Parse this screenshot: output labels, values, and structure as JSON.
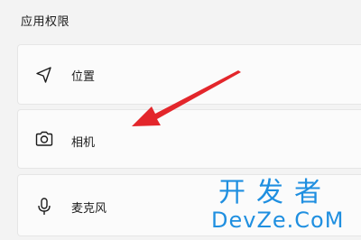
{
  "section": {
    "title": "应用权限"
  },
  "permissions": [
    {
      "label": "位置",
      "icon": "location-arrow-icon"
    },
    {
      "label": "相机",
      "icon": "camera-icon"
    },
    {
      "label": "麦克风",
      "icon": "microphone-icon"
    }
  ],
  "annotation": {
    "arrow_color": "#e3262b"
  },
  "watermark": {
    "line1": "开发者",
    "line2": "DevZe.CoM",
    "color": "#1f8fe0"
  }
}
